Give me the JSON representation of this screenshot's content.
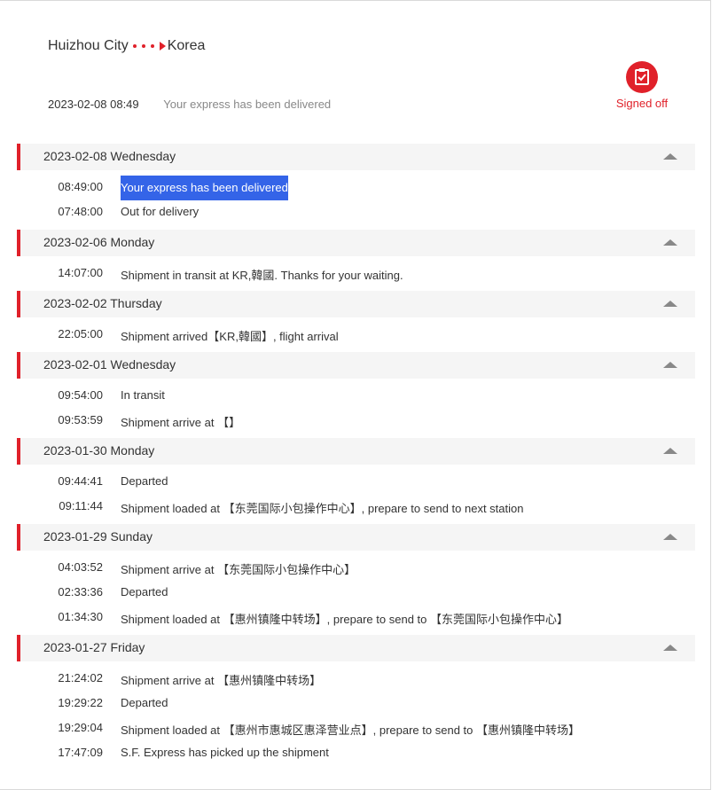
{
  "route": {
    "from": "Huizhou City",
    "to": "Korea"
  },
  "latest": {
    "time": "2023-02-08 08:49",
    "message": "Your express has been delivered"
  },
  "status": {
    "label": "Signed off",
    "icon": "signed-clipboard-icon",
    "color": "#e0212a"
  },
  "groups": [
    {
      "date": "2023-02-08 Wednesday",
      "events": [
        {
          "time": "08:49:00",
          "message": "Your express has been delivered",
          "selected": true
        },
        {
          "time": "07:48:00",
          "message": "Out for delivery"
        }
      ]
    },
    {
      "date": "2023-02-06 Monday",
      "events": [
        {
          "time": "14:07:00",
          "message": "Shipment in transit at KR,韓國. Thanks for your waiting."
        }
      ]
    },
    {
      "date": "2023-02-02 Thursday",
      "events": [
        {
          "time": "22:05:00",
          "message": "Shipment arrived【KR,韓國】, flight arrival"
        }
      ]
    },
    {
      "date": "2023-02-01 Wednesday",
      "events": [
        {
          "time": "09:54:00",
          "message": "In transit"
        },
        {
          "time": "09:53:59",
          "message": "Shipment arrive at 【】"
        }
      ]
    },
    {
      "date": "2023-01-30 Monday",
      "events": [
        {
          "time": "09:44:41",
          "message": "Departed"
        },
        {
          "time": "09:11:44",
          "message": "Shipment loaded at 【东莞国际小包操作中心】, prepare to send to next station"
        }
      ]
    },
    {
      "date": "2023-01-29 Sunday",
      "events": [
        {
          "time": "04:03:52",
          "message": "Shipment arrive at 【东莞国际小包操作中心】"
        },
        {
          "time": "02:33:36",
          "message": "Departed"
        },
        {
          "time": "01:34:30",
          "message": "Shipment loaded at 【惠州镇隆中转场】, prepare to send to 【东莞国际小包操作中心】"
        }
      ]
    },
    {
      "date": "2023-01-27 Friday",
      "events": [
        {
          "time": "21:24:02",
          "message": "Shipment arrive at 【惠州镇隆中转场】"
        },
        {
          "time": "19:29:22",
          "message": "Departed"
        },
        {
          "time": "19:29:04",
          "message": "Shipment loaded at 【惠州市惠城区惠泽营业点】, prepare to send to 【惠州镇隆中转场】"
        },
        {
          "time": "17:47:09",
          "message": "S.F. Express has picked up the shipment"
        }
      ]
    }
  ]
}
